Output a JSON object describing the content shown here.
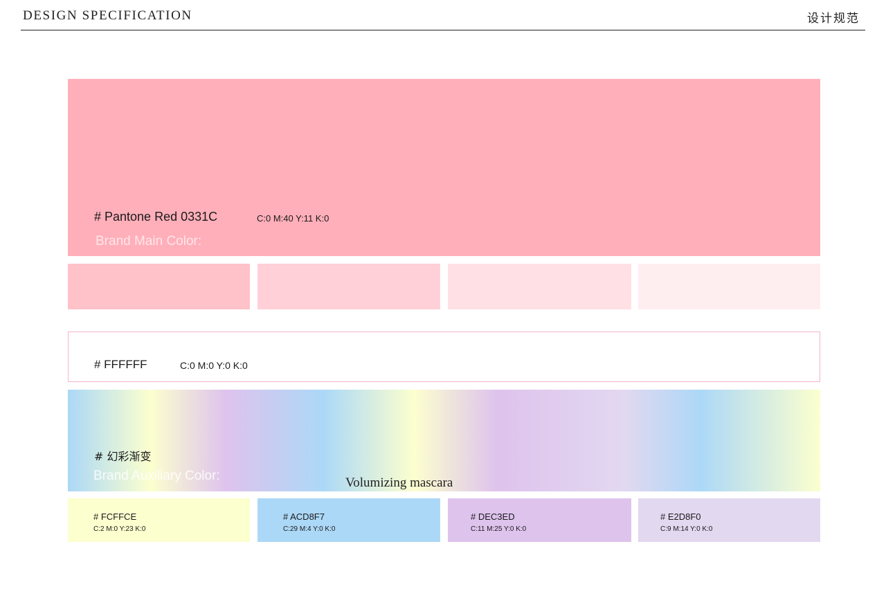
{
  "header": {
    "title": "DESIGN SPECIFICATION",
    "title_cn": "设计规范"
  },
  "main_color": {
    "hex_label": "# Pantone Red 0331C",
    "cmyk": "C:0 M:40 Y:11 K:0",
    "label": "Brand Main Color:",
    "color": "#ffafba",
    "tints": [
      "#ffc2c9",
      "#ffd0d7",
      "#ffe0e4",
      "#ffeef0"
    ]
  },
  "white_color": {
    "hex_label": "# FFFFFF",
    "cmyk": "C:0 M:0 Y:0 K:0",
    "color": "#ffffff"
  },
  "gradient": {
    "hex_label": "# 幻彩渐变",
    "label": "Brand Auxiliary Color:",
    "caption": "Volumizing mascara"
  },
  "aux_colors": [
    {
      "hex_label": "# FCFFCE",
      "cmyk": "C:2 M:0 Y:23 K:0",
      "color": "#fcffce"
    },
    {
      "hex_label": "# ACD8F7",
      "cmyk": "C:29 M:4 Y:0 K:0",
      "color": "#acd8f7"
    },
    {
      "hex_label": "# DEC3ED",
      "cmyk": "C:11 M:25 Y:0 K:0",
      "color": "#dec3ed"
    },
    {
      "hex_label": "# E2D8F0",
      "cmyk": "C:9 M:14 Y:0 K:0",
      "color": "#e2d8f0"
    }
  ]
}
